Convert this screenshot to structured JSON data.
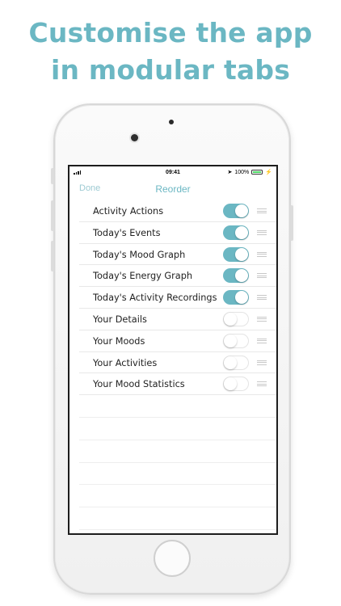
{
  "headline": {
    "line1": "Customise the app",
    "line2": "in modular tabs"
  },
  "status_bar": {
    "time": "09:41",
    "battery_percent": "100%",
    "icons": [
      "signal-icon",
      "location-icon",
      "battery-icon",
      "charging-icon"
    ]
  },
  "nav": {
    "done_label": "Done",
    "title": "Reorder"
  },
  "rows": [
    {
      "label": "Activity Actions",
      "enabled": true
    },
    {
      "label": "Today's Events",
      "enabled": true
    },
    {
      "label": "Today's Mood Graph",
      "enabled": true
    },
    {
      "label": "Today's Energy Graph",
      "enabled": true
    },
    {
      "label": "Today's Activity Recordings",
      "enabled": true
    },
    {
      "label": "Your Details",
      "enabled": false
    },
    {
      "label": "Your Moods",
      "enabled": false
    },
    {
      "label": "Your Activities",
      "enabled": false
    },
    {
      "label": "Your Mood Statistics",
      "enabled": false
    }
  ],
  "colors": {
    "accent": "#6bb7c3",
    "toggle_off": "#ffffff",
    "battery": "#4cd964"
  }
}
